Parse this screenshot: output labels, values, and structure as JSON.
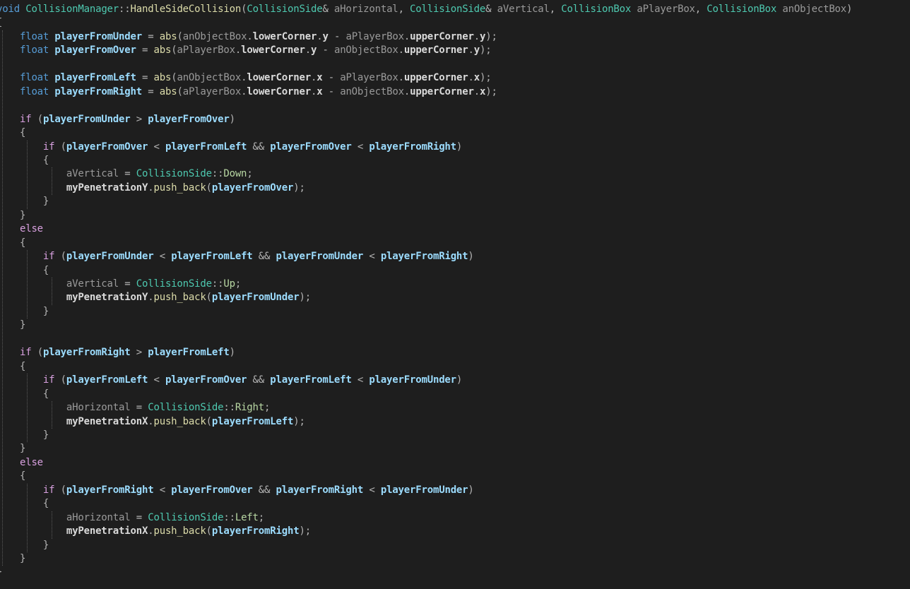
{
  "editor": {
    "background": "#1e1e1e",
    "colors": {
      "keyword": "#569cd6",
      "control": "#d8a0df",
      "type": "#4ec9b0",
      "function": "#dcdcaa",
      "local_variable": "#9cdcfe",
      "parameter": "#9a9a9a",
      "member": "#dadada",
      "enum_value": "#b8d7a3",
      "punctuation": "#b4b4b4"
    },
    "lines": [
      [
        [
          "kw",
          "void"
        ],
        [
          "p",
          " "
        ],
        [
          "type",
          "CollisionManager"
        ],
        [
          "p",
          "::"
        ],
        [
          "fn",
          "HandleSideCollision"
        ],
        [
          "p",
          "("
        ],
        [
          "type",
          "CollisionSide"
        ],
        [
          "p",
          "& "
        ],
        [
          "param",
          "aHorizontal"
        ],
        [
          "p",
          ", "
        ],
        [
          "type",
          "CollisionSide"
        ],
        [
          "p",
          "& "
        ],
        [
          "param",
          "aVertical"
        ],
        [
          "p",
          ", "
        ],
        [
          "type",
          "CollisionBox"
        ],
        [
          "p",
          " "
        ],
        [
          "param",
          "aPlayerBox"
        ],
        [
          "p",
          ", "
        ],
        [
          "type",
          "CollisionBox"
        ],
        [
          "p",
          " "
        ],
        [
          "param",
          "anObjectBox"
        ],
        [
          "p",
          ")"
        ]
      ],
      [
        [
          "p",
          "{"
        ]
      ],
      [
        [
          "p",
          "    "
        ],
        [
          "kw",
          "float"
        ],
        [
          "p",
          " "
        ],
        [
          "var",
          "playerFromUnder"
        ],
        [
          "p",
          " = "
        ],
        [
          "fn",
          "abs"
        ],
        [
          "p",
          "("
        ],
        [
          "param",
          "anObjectBox"
        ],
        [
          "p",
          "."
        ],
        [
          "member",
          "lowerCorner"
        ],
        [
          "p",
          "."
        ],
        [
          "member",
          "y"
        ],
        [
          "p",
          " - "
        ],
        [
          "param",
          "aPlayerBox"
        ],
        [
          "p",
          "."
        ],
        [
          "member",
          "upperCorner"
        ],
        [
          "p",
          "."
        ],
        [
          "member",
          "y"
        ],
        [
          "p",
          ");"
        ]
      ],
      [
        [
          "p",
          "    "
        ],
        [
          "kw",
          "float"
        ],
        [
          "p",
          " "
        ],
        [
          "var",
          "playerFromOver"
        ],
        [
          "p",
          " = "
        ],
        [
          "fn",
          "abs"
        ],
        [
          "p",
          "("
        ],
        [
          "param",
          "aPlayerBox"
        ],
        [
          "p",
          "."
        ],
        [
          "member",
          "lowerCorner"
        ],
        [
          "p",
          "."
        ],
        [
          "member",
          "y"
        ],
        [
          "p",
          " - "
        ],
        [
          "param",
          "anObjectBox"
        ],
        [
          "p",
          "."
        ],
        [
          "member",
          "upperCorner"
        ],
        [
          "p",
          "."
        ],
        [
          "member",
          "y"
        ],
        [
          "p",
          ");"
        ]
      ],
      [],
      [
        [
          "p",
          "    "
        ],
        [
          "kw",
          "float"
        ],
        [
          "p",
          " "
        ],
        [
          "var",
          "playerFromLeft"
        ],
        [
          "p",
          " = "
        ],
        [
          "fn",
          "abs"
        ],
        [
          "p",
          "("
        ],
        [
          "param",
          "anObjectBox"
        ],
        [
          "p",
          "."
        ],
        [
          "member",
          "lowerCorner"
        ],
        [
          "p",
          "."
        ],
        [
          "member",
          "x"
        ],
        [
          "p",
          " - "
        ],
        [
          "param",
          "aPlayerBox"
        ],
        [
          "p",
          "."
        ],
        [
          "member",
          "upperCorner"
        ],
        [
          "p",
          "."
        ],
        [
          "member",
          "x"
        ],
        [
          "p",
          ");"
        ]
      ],
      [
        [
          "p",
          "    "
        ],
        [
          "kw",
          "float"
        ],
        [
          "p",
          " "
        ],
        [
          "var",
          "playerFromRight"
        ],
        [
          "p",
          " = "
        ],
        [
          "fn",
          "abs"
        ],
        [
          "p",
          "("
        ],
        [
          "param",
          "aPlayerBox"
        ],
        [
          "p",
          "."
        ],
        [
          "member",
          "lowerCorner"
        ],
        [
          "p",
          "."
        ],
        [
          "member",
          "x"
        ],
        [
          "p",
          " - "
        ],
        [
          "param",
          "anObjectBox"
        ],
        [
          "p",
          "."
        ],
        [
          "member",
          "upperCorner"
        ],
        [
          "p",
          "."
        ],
        [
          "member",
          "x"
        ],
        [
          "p",
          ");"
        ]
      ],
      [],
      [
        [
          "p",
          "    "
        ],
        [
          "ctl",
          "if"
        ],
        [
          "p",
          " ("
        ],
        [
          "var",
          "playerFromUnder"
        ],
        [
          "p",
          " > "
        ],
        [
          "var",
          "playerFromOver"
        ],
        [
          "p",
          ")"
        ]
      ],
      [
        [
          "p",
          "    {"
        ]
      ],
      [
        [
          "p",
          "        "
        ],
        [
          "ctl",
          "if"
        ],
        [
          "p",
          " ("
        ],
        [
          "var",
          "playerFromOver"
        ],
        [
          "p",
          " < "
        ],
        [
          "var",
          "playerFromLeft"
        ],
        [
          "p",
          " && "
        ],
        [
          "var",
          "playerFromOver"
        ],
        [
          "p",
          " < "
        ],
        [
          "var",
          "playerFromRight"
        ],
        [
          "p",
          ")"
        ]
      ],
      [
        [
          "p",
          "        {"
        ]
      ],
      [
        [
          "p",
          "            "
        ],
        [
          "param",
          "aVertical"
        ],
        [
          "p",
          " = "
        ],
        [
          "type",
          "CollisionSide"
        ],
        [
          "p",
          "::"
        ],
        [
          "enum",
          "Down"
        ],
        [
          "p",
          ";"
        ]
      ],
      [
        [
          "p",
          "            "
        ],
        [
          "member",
          "myPenetrationY"
        ],
        [
          "p",
          "."
        ],
        [
          "fn",
          "push_back"
        ],
        [
          "p",
          "("
        ],
        [
          "var",
          "playerFromOver"
        ],
        [
          "p",
          ");"
        ]
      ],
      [
        [
          "p",
          "        }"
        ]
      ],
      [
        [
          "p",
          "    }"
        ]
      ],
      [
        [
          "p",
          "    "
        ],
        [
          "ctl",
          "else"
        ]
      ],
      [
        [
          "p",
          "    {"
        ]
      ],
      [
        [
          "p",
          "        "
        ],
        [
          "ctl",
          "if"
        ],
        [
          "p",
          " ("
        ],
        [
          "var",
          "playerFromUnder"
        ],
        [
          "p",
          " < "
        ],
        [
          "var",
          "playerFromLeft"
        ],
        [
          "p",
          " && "
        ],
        [
          "var",
          "playerFromUnder"
        ],
        [
          "p",
          " < "
        ],
        [
          "var",
          "playerFromRight"
        ],
        [
          "p",
          ")"
        ]
      ],
      [
        [
          "p",
          "        {"
        ]
      ],
      [
        [
          "p",
          "            "
        ],
        [
          "param",
          "aVertical"
        ],
        [
          "p",
          " = "
        ],
        [
          "type",
          "CollisionSide"
        ],
        [
          "p",
          "::"
        ],
        [
          "enum",
          "Up"
        ],
        [
          "p",
          ";"
        ]
      ],
      [
        [
          "p",
          "            "
        ],
        [
          "member",
          "myPenetrationY"
        ],
        [
          "p",
          "."
        ],
        [
          "fn",
          "push_back"
        ],
        [
          "p",
          "("
        ],
        [
          "var",
          "playerFromUnder"
        ],
        [
          "p",
          ");"
        ]
      ],
      [
        [
          "p",
          "        }"
        ]
      ],
      [
        [
          "p",
          "    }"
        ]
      ],
      [],
      [
        [
          "p",
          "    "
        ],
        [
          "ctl",
          "if"
        ],
        [
          "p",
          " ("
        ],
        [
          "var",
          "playerFromRight"
        ],
        [
          "p",
          " > "
        ],
        [
          "var",
          "playerFromLeft"
        ],
        [
          "p",
          ")"
        ]
      ],
      [
        [
          "p",
          "    {"
        ]
      ],
      [
        [
          "p",
          "        "
        ],
        [
          "ctl",
          "if"
        ],
        [
          "p",
          " ("
        ],
        [
          "var",
          "playerFromLeft"
        ],
        [
          "p",
          " < "
        ],
        [
          "var",
          "playerFromOver"
        ],
        [
          "p",
          " && "
        ],
        [
          "var",
          "playerFromLeft"
        ],
        [
          "p",
          " < "
        ],
        [
          "var",
          "playerFromUnder"
        ],
        [
          "p",
          ")"
        ]
      ],
      [
        [
          "p",
          "        {"
        ]
      ],
      [
        [
          "p",
          "            "
        ],
        [
          "param",
          "aHorizontal"
        ],
        [
          "p",
          " = "
        ],
        [
          "type",
          "CollisionSide"
        ],
        [
          "p",
          "::"
        ],
        [
          "enum",
          "Right"
        ],
        [
          "p",
          ";"
        ]
      ],
      [
        [
          "p",
          "            "
        ],
        [
          "member",
          "myPenetrationX"
        ],
        [
          "p",
          "."
        ],
        [
          "fn",
          "push_back"
        ],
        [
          "p",
          "("
        ],
        [
          "var",
          "playerFromLeft"
        ],
        [
          "p",
          ");"
        ]
      ],
      [
        [
          "p",
          "        }"
        ]
      ],
      [
        [
          "p",
          "    }"
        ]
      ],
      [
        [
          "p",
          "    "
        ],
        [
          "ctl",
          "else"
        ]
      ],
      [
        [
          "p",
          "    {"
        ]
      ],
      [
        [
          "p",
          "        "
        ],
        [
          "ctl",
          "if"
        ],
        [
          "p",
          " ("
        ],
        [
          "var",
          "playerFromRight"
        ],
        [
          "p",
          " < "
        ],
        [
          "var",
          "playerFromOver"
        ],
        [
          "p",
          " && "
        ],
        [
          "var",
          "playerFromRight"
        ],
        [
          "p",
          " < "
        ],
        [
          "var",
          "playerFromUnder"
        ],
        [
          "p",
          ")"
        ]
      ],
      [
        [
          "p",
          "        {"
        ]
      ],
      [
        [
          "p",
          "            "
        ],
        [
          "param",
          "aHorizontal"
        ],
        [
          "p",
          " = "
        ],
        [
          "type",
          "CollisionSide"
        ],
        [
          "p",
          "::"
        ],
        [
          "enum",
          "Left"
        ],
        [
          "p",
          ";"
        ]
      ],
      [
        [
          "p",
          "            "
        ],
        [
          "member",
          "myPenetrationX"
        ],
        [
          "p",
          "."
        ],
        [
          "fn",
          "push_back"
        ],
        [
          "p",
          "("
        ],
        [
          "var",
          "playerFromRight"
        ],
        [
          "p",
          ");"
        ]
      ],
      [
        [
          "p",
          "        }"
        ]
      ],
      [
        [
          "p",
          "    }"
        ]
      ],
      [
        [
          "p",
          "}"
        ]
      ]
    ]
  }
}
